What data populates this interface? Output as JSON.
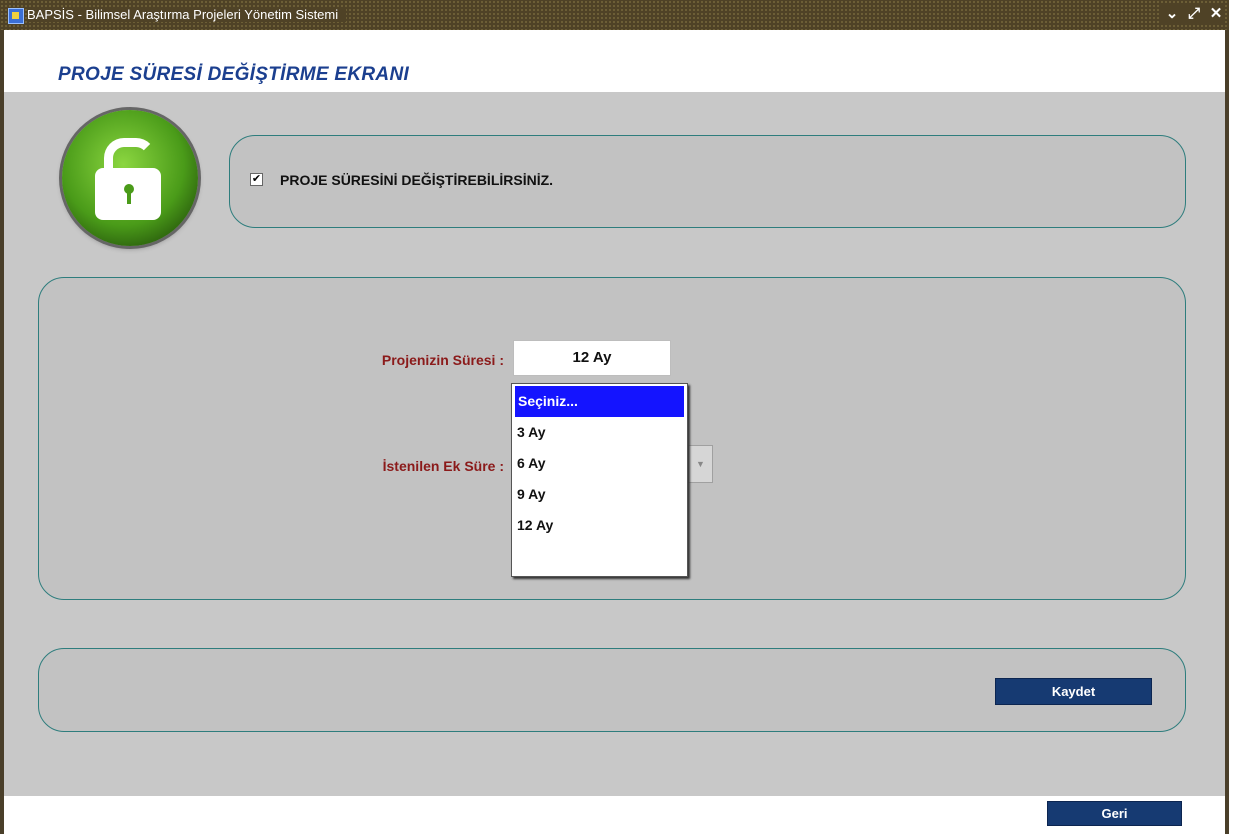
{
  "window": {
    "title": "BAPSİS - Bilimsel Araştırma Projeleri Yönetim Sistemi",
    "controls": {
      "minimize": "⌄",
      "restore": "⤢",
      "close": "✕"
    }
  },
  "page": {
    "title": "PROJE SÜRESİ DEĞİŞTİRME EKRANI"
  },
  "status": {
    "icon": "unlocked-padlock-icon",
    "checkbox_checked": "✔",
    "message": "PROJE SÜRESİNİ DEĞİŞTİREBİLİRSİNİZ."
  },
  "form": {
    "duration_label": "Projenizin Süresi :",
    "duration_value": "12 Ay",
    "extension_label": "İstenilen Ek Süre :",
    "extension_options": [
      "Seçiniz...",
      "3 Ay",
      "6 Ay",
      "9 Ay",
      "12 Ay"
    ],
    "extension_selected": "Seçiniz..."
  },
  "actions": {
    "save_label": "Kaydet",
    "back_label": "Geri"
  },
  "colors": {
    "title_bar": "#4f4226",
    "page_title": "#1b3f8f",
    "label": "#8b1a1a",
    "button": "#163a72",
    "highlight": "#1414ff",
    "panel_border": "#2e7d7d"
  }
}
